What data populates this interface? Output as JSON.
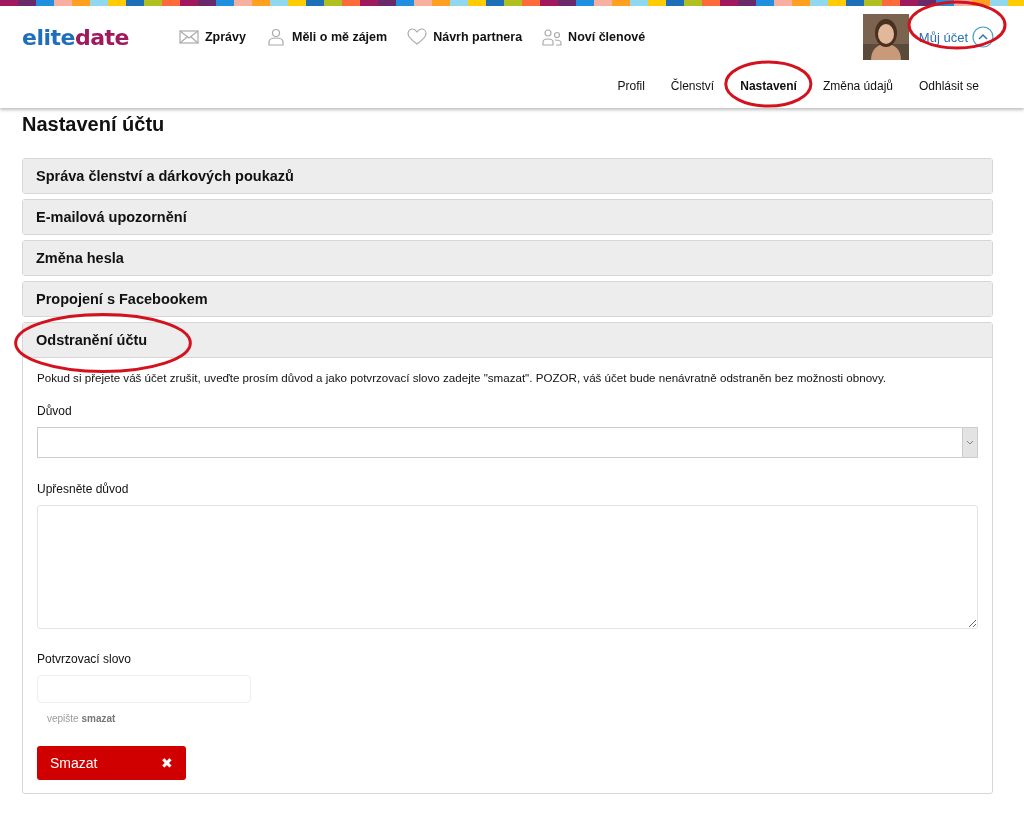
{
  "header": {
    "logo": {
      "part_1": "elite",
      "part_2": "date"
    },
    "nav": [
      {
        "kind": "mail",
        "label": "Zprávy"
      },
      {
        "kind": "person",
        "label": "Měli o mě zájem"
      },
      {
        "kind": "heart",
        "label": "Návrh partnera"
      },
      {
        "kind": "people",
        "label": "Noví členové"
      }
    ],
    "account": {
      "label": "Můj účet",
      "expanded": true,
      "circled": true
    },
    "subnav": [
      {
        "label": "Profil",
        "selected": false,
        "circled": false
      },
      {
        "label": "Členství",
        "selected": false,
        "circled": false
      },
      {
        "label": "Nastavení",
        "selected": true,
        "circled": true
      },
      {
        "label": "Změna údajů",
        "selected": false,
        "circled": false
      },
      {
        "label": "Odhlásit se",
        "selected": false,
        "circled": false
      }
    ]
  },
  "page_title": "Nastavení účtu",
  "sections": [
    {
      "title": "Správa členství a dárkových poukazů",
      "expanded": false,
      "circled": false
    },
    {
      "title": "E-mailová upozornění",
      "expanded": false,
      "circled": false
    },
    {
      "title": "Změna hesla",
      "expanded": false,
      "circled": false
    },
    {
      "title": "Propojení s Facebookem",
      "expanded": false,
      "circled": false
    },
    {
      "title": "Odstranění účtu",
      "expanded": true,
      "circled": true,
      "intro": "Pokud si přejete váš účet zrušit, uveďte prosím důvod a jako potvrzovací slovo zadejte \"smazat\". POZOR, váš účet bude nenávratně odstraněn bez možnosti obnovy.",
      "fields": [
        {
          "kind": "select",
          "label": "Důvod"
        },
        {
          "kind": "textarea",
          "label": "Upřesněte důvod"
        },
        {
          "kind": "input",
          "label": "Potvrzovací slovo",
          "hint": "vepište **smazat**"
        }
      ],
      "button": {
        "label": "Smazat",
        "icon": "✖"
      }
    }
  ]
}
